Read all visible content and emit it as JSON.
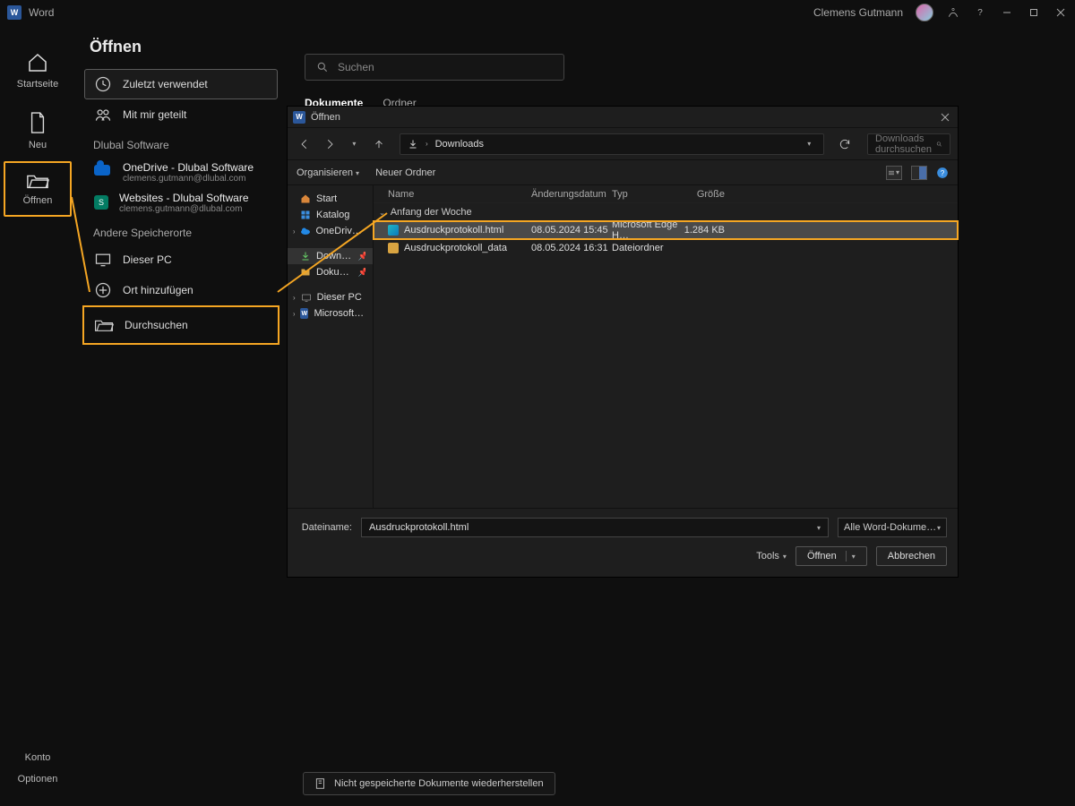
{
  "titlebar": {
    "app_name": "Word",
    "user_name": "Clemens Gutmann",
    "window_min": "—",
    "window_max": "▢",
    "window_close": "✕",
    "help": "?"
  },
  "leftrail": {
    "home": "Startseite",
    "new": "Neu",
    "open": "Öffnen",
    "account": "Konto",
    "options": "Optionen"
  },
  "backstage": {
    "title": "Öffnen",
    "recent": "Zuletzt verwendet",
    "shared": "Mit mir geteilt",
    "org_label": "Dlubal Software",
    "onedrive_title": "OneDrive - Dlubal Software",
    "onedrive_email": "clemens.gutmann@dlubal.com",
    "sharepoint_title": "Websites - Dlubal Software",
    "sharepoint_email": "clemens.gutmann@dlubal.com",
    "other_label": "Andere Speicherorte",
    "this_pc": "Dieser PC",
    "add_place": "Ort hinzufügen",
    "browse": "Durchsuchen"
  },
  "main": {
    "search_placeholder": "Suchen",
    "tab_docs": "Dokumente",
    "tab_folders": "Ordner",
    "restore_label": "Nicht gespeicherte Dokumente wiederherstellen"
  },
  "dialog": {
    "title": "Öffnen",
    "path_current": "Downloads",
    "search_placeholder": "Downloads durchsuchen",
    "toolbar_organize": "Organisieren",
    "toolbar_newfolder": "Neuer Ordner",
    "tree": {
      "start": "Start",
      "katalog": "Katalog",
      "onedrive": "OneDrive - Dlubal…",
      "downloads": "Downloads",
      "documents": "Dokumente",
      "this_pc": "Dieser PC",
      "word": "Microsoft Word"
    },
    "cols": {
      "name": "Name",
      "date": "Änderungsdatum",
      "type": "Typ",
      "size": "Größe"
    },
    "group_header": "Anfang der Woche",
    "rows": [
      {
        "name": "Ausdruckprotokoll.html",
        "date": "08.05.2024 15:45",
        "type": "Microsoft Edge H…",
        "size": "1.284 KB",
        "sel": true,
        "kind": "edge"
      },
      {
        "name": "Ausdruckprotokoll_data",
        "date": "08.05.2024 16:31",
        "type": "Dateiordner",
        "size": "",
        "sel": false,
        "kind": "folder"
      }
    ],
    "footer": {
      "filename_label": "Dateiname:",
      "filename_value": "Ausdruckprotokoll.html",
      "filter_value": "Alle Word-Dokumente (*.docx; …",
      "tools": "Tools",
      "open_btn": "Öffnen",
      "cancel_btn": "Abbrechen"
    }
  }
}
